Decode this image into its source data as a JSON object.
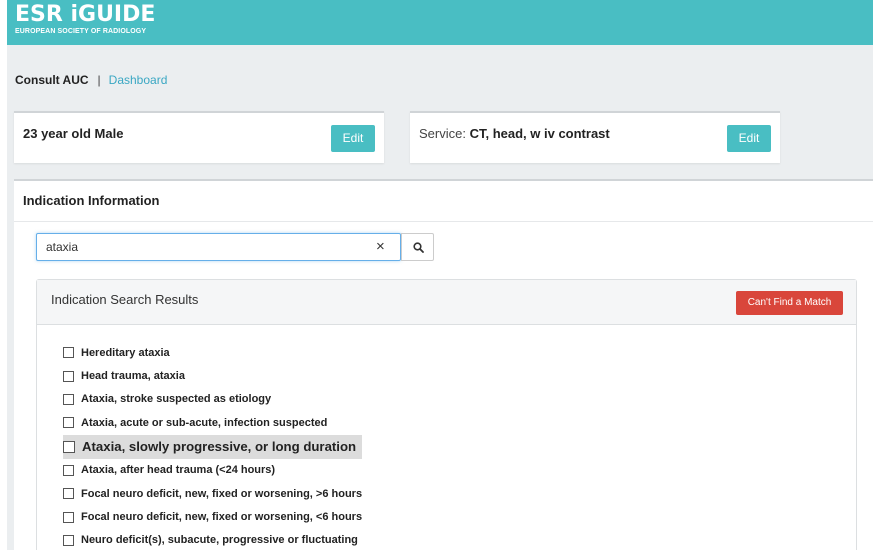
{
  "header": {
    "logo_main": "ESR iGUIDE",
    "logo_sub": "EUROPEAN SOCIETY OF RADIOLOGY"
  },
  "breadcrumb": {
    "current": "Consult AUC",
    "separator": "|",
    "link": "Dashboard"
  },
  "patient": {
    "summary": "23 year old Male",
    "edit_label": "Edit"
  },
  "service": {
    "label": "Service:",
    "value": "CT, head, w iv contrast",
    "edit_label": "Edit"
  },
  "indication": {
    "heading": "Indication Information",
    "search_value": "ataxia",
    "clear_glyph": "×"
  },
  "results": {
    "title": "Indication Search Results",
    "no_match_label": "Can't Find a Match",
    "items": [
      "Hereditary ataxia",
      "Head trauma, ataxia",
      "Ataxia, stroke suspected as etiology",
      "Ataxia, acute or sub-acute, infection suspected",
      "Ataxia, slowly progressive, or long duration",
      "Ataxia, after head trauma (<24 hours)",
      "Focal neuro deficit, new, fixed or worsening, >6 hours",
      "Focal neuro deficit, new, fixed or worsening, <6 hours",
      "Neuro deficit(s), subacute, progressive or fluctuating"
    ]
  },
  "colors": {
    "brand_teal": "#49bec3",
    "danger_red": "#d9463b",
    "link_blue": "#3aa7c3"
  }
}
